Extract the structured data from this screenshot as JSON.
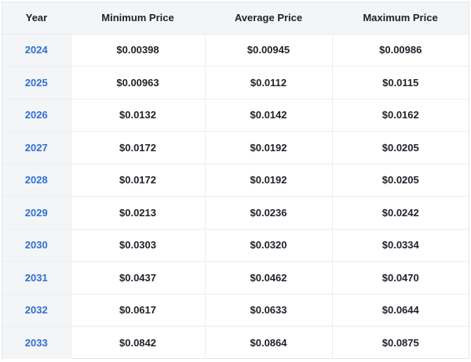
{
  "table": {
    "headers": [
      "Year",
      "Minimum Price",
      "Average Price",
      "Maximum Price"
    ],
    "rows": [
      {
        "year": "2024",
        "min": "$0.00398",
        "avg": "$0.00945",
        "max": "$0.00986"
      },
      {
        "year": "2025",
        "min": "$0.00963",
        "avg": "$0.0112",
        "max": "$0.0115"
      },
      {
        "year": "2026",
        "min": "$0.0132",
        "avg": "$0.0142",
        "max": "$0.0162"
      },
      {
        "year": "2027",
        "min": "$0.0172",
        "avg": "$0.0192",
        "max": "$0.0205"
      },
      {
        "year": "2028",
        "min": "$0.0172",
        "avg": "$0.0192",
        "max": "$0.0205"
      },
      {
        "year": "2029",
        "min": "$0.0213",
        "avg": "$0.0236",
        "max": "$0.0242"
      },
      {
        "year": "2030",
        "min": "$0.0303",
        "avg": "$0.0320",
        "max": "$0.0334"
      },
      {
        "year": "2031",
        "min": "$0.0437",
        "avg": "$0.0462",
        "max": "$0.0470"
      },
      {
        "year": "2032",
        "min": "$0.0617",
        "avg": "$0.0633",
        "max": "$0.0644"
      },
      {
        "year": "2033",
        "min": "$0.0842",
        "avg": "$0.0864",
        "max": "$0.0875"
      }
    ]
  },
  "colors": {
    "year_link": "#2f6fd1",
    "header_bg": "#f4f5f7",
    "text": "#1d2128"
  }
}
